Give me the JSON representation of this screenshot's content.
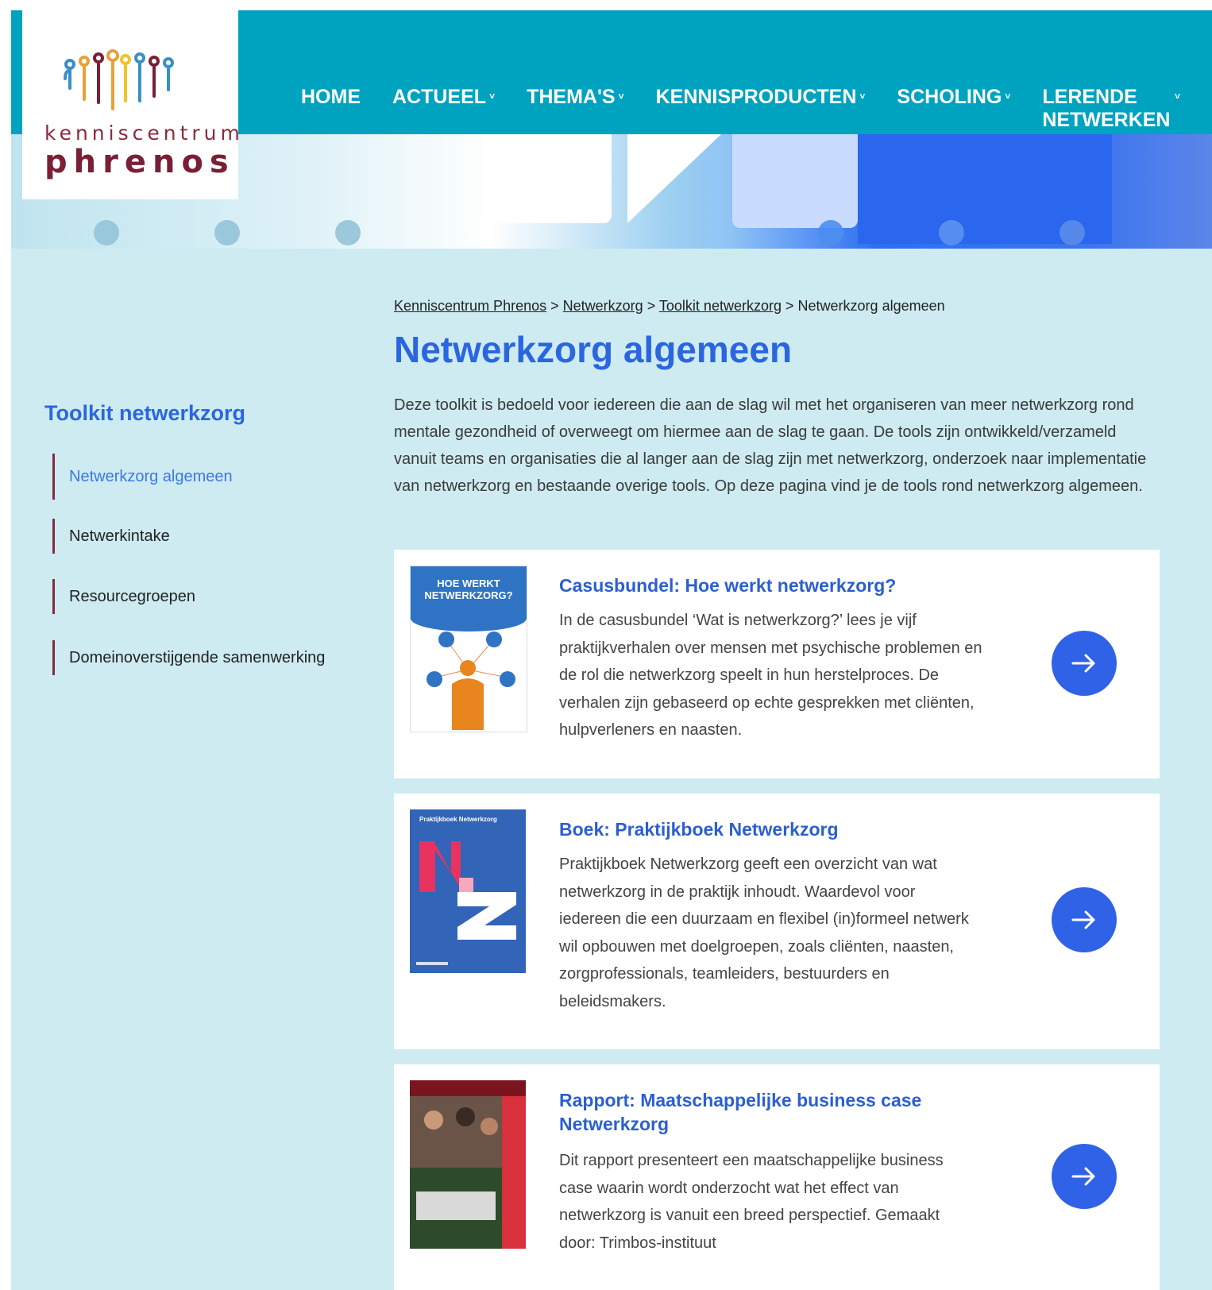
{
  "header": {
    "logo": {
      "line1": "kenniscentrum",
      "line2": "phrenos"
    },
    "nav": [
      {
        "label": "HOME",
        "dropdown": false
      },
      {
        "label": "ACTUEEL",
        "dropdown": true
      },
      {
        "label": "THEMA'S",
        "dropdown": true
      },
      {
        "label": "KENNISPRODUCTEN",
        "dropdown": true
      },
      {
        "label": "SCHOLING",
        "dropdown": true
      },
      {
        "label": "LERENDE NETWERKEN",
        "dropdown": true
      }
    ]
  },
  "breadcrumb": {
    "items": [
      "Kenniscentrum Phrenos",
      "Netwerkzorg",
      "Toolkit netwerkzorg"
    ],
    "current": "Netwerkzorg algemeen",
    "separator": ">"
  },
  "main": {
    "title": "Netwerkzorg algemeen",
    "intro": "Deze toolkit is bedoeld voor iedereen die aan de slag wil met het organiseren van meer netwerkzorg rond mentale gezondheid of overweegt om hiermee aan de slag te gaan. De tools zijn ontwikkeld/verzameld vanuit teams en organisaties die al langer aan de slag zijn met netwerkzorg, onderzoek naar implementatie van netwerkzorg en bestaande overige tools. Op deze pagina vind je de tools rond netwerkzorg algemeen."
  },
  "sidebar": {
    "title": "Toolkit netwerkzorg",
    "items": [
      {
        "label": "Netwerkzorg algemeen",
        "active": true
      },
      {
        "label": "Netwerkintake",
        "active": false
      },
      {
        "label": "Resourcegroepen",
        "active": false
      },
      {
        "label": "Domeinoverstijgende samenwerking",
        "active": false
      }
    ]
  },
  "cards": [
    {
      "title": "Casusbundel: Hoe werkt netwerkzorg?",
      "description": "In de casusbundel ‘Wat is netwerkzorg?’ lees je vijf praktijkverhalen over mensen met psychische problemen en de rol die netwerkzorg speelt in hun herstelproces. De verhalen zijn gebaseerd op echte gesprekken met cliënten, hulpverleners en naasten.",
      "cover": {
        "heading": "HOE WERKT NETWERKZORG?"
      },
      "icon": "arrow-right-icon"
    },
    {
      "title": "Boek: Praktijkboek Netwerkzorg",
      "description": "Praktijkboek Netwerkzorg geeft een overzicht van wat netwerkzorg in de praktijk inhoudt. Waardevol voor iedereen die een duurzaam en flexibel (in)formeel netwerk wil opbouwen met doelgroepen, zoals cliënten, naasten, zorgprofessionals, teamleiders, bestuurders en beleidsmakers.",
      "cover": {
        "heading": "Praktijkboek Netwerkzorg"
      },
      "icon": "arrow-right-icon"
    },
    {
      "title": "Rapport: Maatschappelijke business case Netwerkzorg",
      "description": "Dit rapport presenteert een maatschappelijke business case waarin wordt onderzocht wat het effect van netwerkzorg is vanuit een breed perspectief. Gemaakt door: Trimbos-instituut",
      "icon": "arrow-right-icon"
    }
  ],
  "colors": {
    "topbar": "#00a3bf",
    "page_bg": "#cdebf1",
    "accent_blue": "#2b66e0",
    "sidebar_marker": "#8b2a3d",
    "arrow_button": "#2f62e6"
  }
}
